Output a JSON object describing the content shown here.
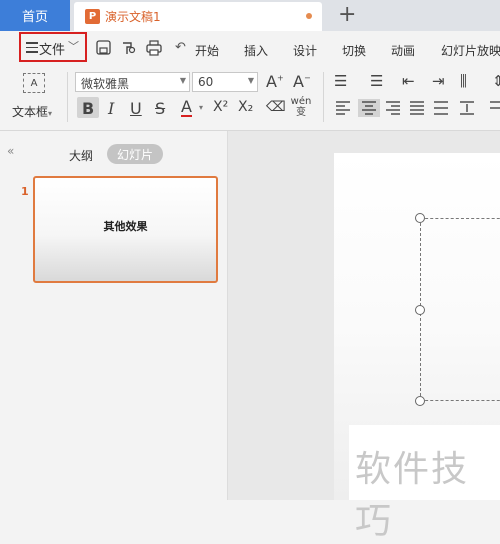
{
  "tabs": {
    "home": "首页",
    "document": "演示文稿1",
    "doc_icon": "P"
  },
  "menu": {
    "file": "文件",
    "items": [
      "开始",
      "插入",
      "设计",
      "切换",
      "动画",
      "幻灯片放映"
    ]
  },
  "toolbar": {
    "textbox_label": "文本框",
    "textbox_icon": "A",
    "font_name": "微软雅黑",
    "font_size": "60",
    "bold": "B",
    "italic": "I",
    "underline": "U",
    "strike": "S",
    "font_color": "A",
    "superscript": "X²",
    "subscript": "X₂",
    "pinyin": "wén 变"
  },
  "panel": {
    "outline_tab": "大纲",
    "slides_tab": "幻灯片",
    "slides": [
      {
        "number": "1",
        "title": "其他效果"
      }
    ]
  },
  "watermark": "软件技巧",
  "colors": {
    "accent_blue": "#3d7ed9",
    "accent_orange": "#e07a3f",
    "highlight_red": "#d72020"
  }
}
